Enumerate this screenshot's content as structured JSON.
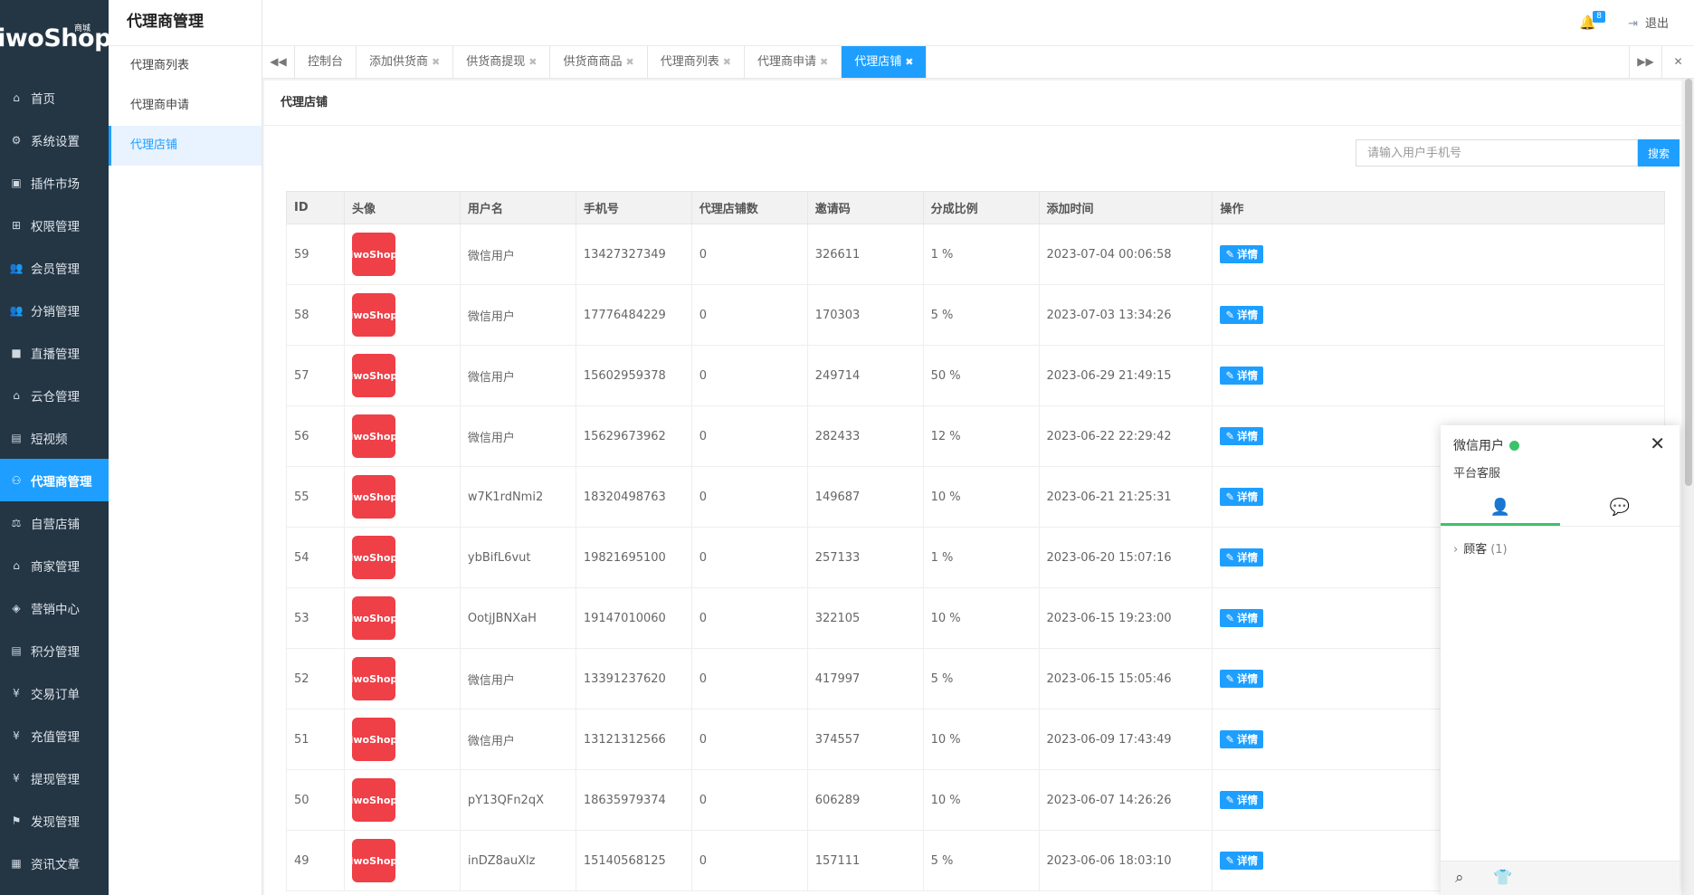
{
  "brand": {
    "logo": "iwoShop",
    "logo_sub": "商城"
  },
  "sidebar": {
    "items": [
      {
        "label": "首页",
        "icon": "home-icon",
        "glyph": "⌂"
      },
      {
        "label": "系统设置",
        "icon": "gear-icon",
        "glyph": "⚙"
      },
      {
        "label": "插件市场",
        "icon": "plugin-icon",
        "glyph": "▣"
      },
      {
        "label": "权限管理",
        "icon": "sitemap-icon",
        "glyph": "⊞"
      },
      {
        "label": "会员管理",
        "icon": "users-icon",
        "glyph": "👥"
      },
      {
        "label": "分销管理",
        "icon": "users-icon",
        "glyph": "👥"
      },
      {
        "label": "直播管理",
        "icon": "video-icon",
        "glyph": "■"
      },
      {
        "label": "云仓管理",
        "icon": "home-icon",
        "glyph": "⌂"
      },
      {
        "label": "短视频",
        "icon": "file-icon",
        "glyph": "▤"
      },
      {
        "label": "代理商管理",
        "icon": "agent-icon",
        "glyph": "⚇"
      },
      {
        "label": "自营店铺",
        "icon": "balance-icon",
        "glyph": "⚖"
      },
      {
        "label": "商家管理",
        "icon": "bank-icon",
        "glyph": "⌂"
      },
      {
        "label": "营销中心",
        "icon": "tag-icon",
        "glyph": "◈"
      },
      {
        "label": "积分管理",
        "icon": "file-icon",
        "glyph": "▤"
      },
      {
        "label": "交易订单",
        "icon": "yen-icon",
        "glyph": "¥"
      },
      {
        "label": "充值管理",
        "icon": "yen-icon",
        "glyph": "¥"
      },
      {
        "label": "提现管理",
        "icon": "yen-icon",
        "glyph": "¥"
      },
      {
        "label": "发现管理",
        "icon": "flag-icon",
        "glyph": "⚑"
      },
      {
        "label": "资讯文章",
        "icon": "news-icon",
        "glyph": "▦"
      }
    ]
  },
  "subside": {
    "title": "代理商管理",
    "items": [
      "代理商列表",
      "代理商申请",
      "代理店铺"
    ]
  },
  "header": {
    "badge": "8",
    "logout": "退出"
  },
  "tabs": [
    "控制台",
    "添加供货商",
    "供货商提现",
    "供货商商品",
    "代理商列表",
    "代理商申请",
    "代理店铺"
  ],
  "panel": {
    "title": "代理店铺"
  },
  "search": {
    "placeholder": "请输入用户手机号",
    "button": "搜索"
  },
  "table": {
    "headers": [
      "ID",
      "头像",
      "用户名",
      "手机号",
      "代理店铺数",
      "邀请码",
      "分成比例",
      "添加时间",
      "操作"
    ],
    "avatar_text": "iwoShop",
    "action_label": "详情",
    "rows": [
      {
        "id": "59",
        "name": "微信用户",
        "phone": "13427327349",
        "shops": "0",
        "code": "326611",
        "ratio": "1 %",
        "time": "2023-07-04 00:06:58"
      },
      {
        "id": "58",
        "name": "微信用户",
        "phone": "17776484229",
        "shops": "0",
        "code": "170303",
        "ratio": "5 %",
        "time": "2023-07-03 13:34:26"
      },
      {
        "id": "57",
        "name": "微信用户",
        "phone": "15602959378",
        "shops": "0",
        "code": "249714",
        "ratio": "50 %",
        "time": "2023-06-29 21:49:15"
      },
      {
        "id": "56",
        "name": "微信用户",
        "phone": "15629673962",
        "shops": "0",
        "code": "282433",
        "ratio": "12 %",
        "time": "2023-06-22 22:29:42"
      },
      {
        "id": "55",
        "name": "w7K1rdNmi2",
        "phone": "18320498763",
        "shops": "0",
        "code": "149687",
        "ratio": "10 %",
        "time": "2023-06-21 21:25:31"
      },
      {
        "id": "54",
        "name": "ybBifL6vut",
        "phone": "19821695100",
        "shops": "0",
        "code": "257133",
        "ratio": "1 %",
        "time": "2023-06-20 15:07:16"
      },
      {
        "id": "53",
        "name": "OotjJBNXaH",
        "phone": "19147010060",
        "shops": "0",
        "code": "322105",
        "ratio": "10 %",
        "time": "2023-06-15 19:23:00"
      },
      {
        "id": "52",
        "name": "微信用户",
        "phone": "13391237620",
        "shops": "0",
        "code": "417997",
        "ratio": "5 %",
        "time": "2023-06-15 15:05:46"
      },
      {
        "id": "51",
        "name": "微信用户",
        "phone": "13121312566",
        "shops": "0",
        "code": "374557",
        "ratio": "10 %",
        "time": "2023-06-09 17:43:49"
      },
      {
        "id": "50",
        "name": "pY13QFn2qX",
        "phone": "18635979374",
        "shops": "0",
        "code": "606289",
        "ratio": "10 %",
        "time": "2023-06-07 14:26:26"
      },
      {
        "id": "49",
        "name": "inDZ8auXlz",
        "phone": "15140568125",
        "shops": "0",
        "code": "157111",
        "ratio": "5 %",
        "time": "2023-06-06 18:03:10"
      }
    ]
  },
  "chat": {
    "user": "微信用户",
    "subtitle": "平台客服",
    "group_label": "顾客",
    "group_count": "(1)"
  },
  "colors": {
    "accent": "#1e9fff",
    "sidebar_bg": "#243544",
    "online": "#3cc36a",
    "avatar_bg": "#ef3f47"
  }
}
